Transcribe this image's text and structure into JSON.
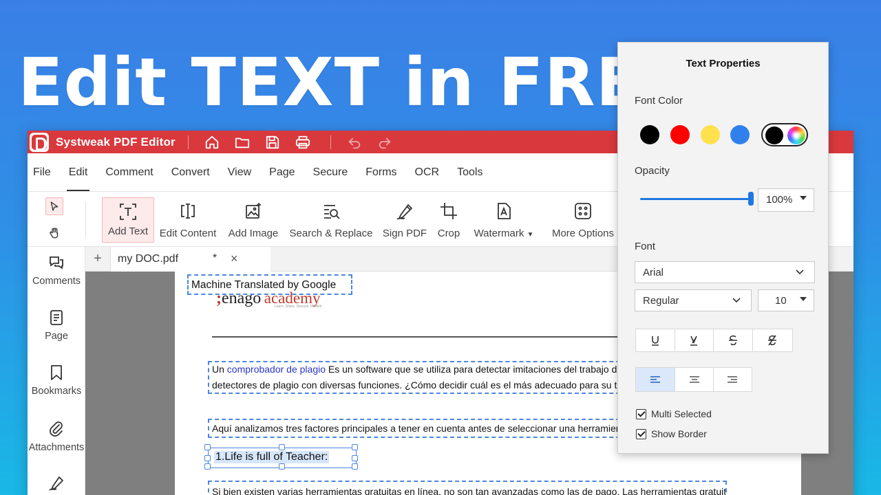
{
  "headline": "Edit TEXT in FREE",
  "app": {
    "title": "Systweak PDF Editor",
    "titlebar_icons": [
      "home-icon",
      "folder-icon",
      "save-icon",
      "print-icon",
      "undo-icon",
      "redo-icon"
    ]
  },
  "menu": {
    "items": [
      "File",
      "Edit",
      "Comment",
      "Convert",
      "View",
      "Page",
      "Secure",
      "Forms",
      "OCR",
      "Tools"
    ],
    "active": "Edit"
  },
  "ribbon": {
    "tools": [
      {
        "label": "Add Text",
        "icon": "add-text-icon"
      },
      {
        "label": "Edit Content",
        "icon": "edit-content-icon"
      },
      {
        "label": "Add Image",
        "icon": "add-image-icon"
      },
      {
        "label": "Search & Replace",
        "icon": "search-replace-icon"
      },
      {
        "label": "Sign PDF",
        "icon": "sign-pen-icon"
      },
      {
        "label": "Crop",
        "icon": "crop-icon"
      },
      {
        "label": "Watermark",
        "icon": "watermark-icon"
      },
      {
        "label": "More Options",
        "icon": "more-options-icon"
      }
    ],
    "active": "Add Text"
  },
  "sidebar": {
    "items": [
      {
        "label": "Comments",
        "icon": "comments-icon"
      },
      {
        "label": "Page",
        "icon": "page-icon"
      },
      {
        "label": "Bookmarks",
        "icon": "bookmark-icon"
      },
      {
        "label": "Attachments",
        "icon": "attachment-icon"
      },
      {
        "label": "",
        "icon": "signature-icon"
      }
    ]
  },
  "tab": {
    "name": "my DOC.pdf",
    "modified_mark": "*",
    "close": "×",
    "add": "+"
  },
  "document": {
    "mt_text": "Machine Translated by Google",
    "logo_enago": "enago",
    "logo_academy": "academy",
    "logo_tagline": "Learn. Share. Discuss. Publish.",
    "para1_link": "comprobador de plagio",
    "para1_pre": "Un ",
    "para1_line1_rest": " Es un software que se utiliza para detectar imitaciones del trabajo de otros.",
    "para1_line2": "detectores de plagio con diversas funciones. ¿Cómo decidir cuál es el más adecuado para su trabajo?",
    "para2": "Aquí analizamos tres factores principales a tener en cuenta antes de seleccionar una herramienta de d",
    "selected_text": "1.Life is full of Teacher:",
    "para3": "Si bien existen varias herramientas gratuitas en línea, no son tan avanzadas como las de pago. Las herramientas gratuitas de"
  },
  "panel": {
    "title": "Text Properties",
    "font_color_label": "Font Color",
    "colors": [
      "#000000",
      "#ff0000",
      "#ffe14d",
      "#2f80ed"
    ],
    "selected_color": "#000000",
    "opacity_label": "Opacity",
    "opacity_value": "100%",
    "opacity_fraction": 1.0,
    "font_label": "Font",
    "font_family": "Arial",
    "font_style": "Regular",
    "font_size": "10",
    "format_buttons": [
      "underline-icon",
      "underline-v-icon",
      "strikethrough-icon",
      "clear-strike-icon"
    ],
    "align_buttons": [
      "align-left-icon",
      "align-center-icon",
      "align-right-icon"
    ],
    "align_selected": "left",
    "multi_selected_label": "Multi Selected",
    "multi_selected_checked": true,
    "show_border_label": "Show Border",
    "show_border_checked": true
  }
}
